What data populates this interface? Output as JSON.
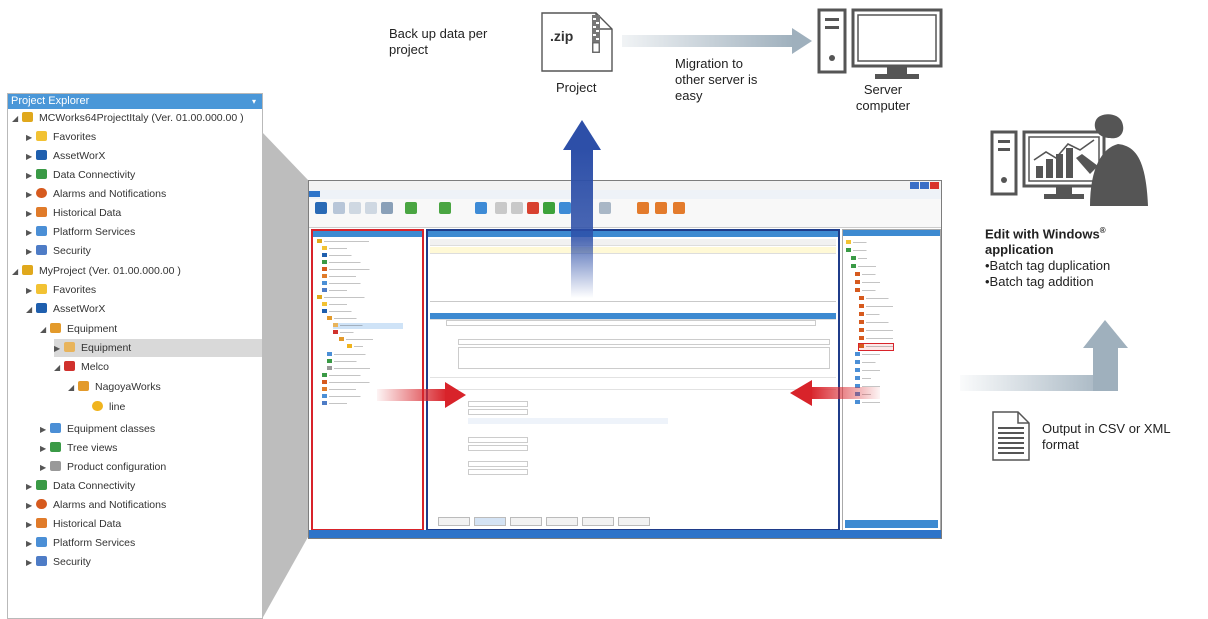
{
  "annotations": {
    "backup_line1": "Back up data per",
    "backup_line2": "project",
    "migration_line1": "Migration to",
    "migration_line2": "other server is",
    "migration_line3": "easy",
    "project_label": "Project",
    "server_line1": "Server",
    "server_line2": "computer",
    "edit_title_line1": "Edit with Windows",
    "edit_title_reg": "®",
    "edit_title_line2": "application",
    "bullet1": "•Batch tag duplication",
    "bullet2": "•Batch tag addition",
    "output_line1": "Output in CSV or XML",
    "output_line2": "format"
  },
  "zip_icon": {
    "label": ".zip"
  },
  "explorer": {
    "title": "Project Explorer",
    "rows": [
      {
        "label": "MCWorks64ProjectItaly (Ver. 01.00.000.00 )",
        "icon": "project-icon",
        "color": "#e0a81c"
      },
      {
        "label": "Favorites",
        "icon": "star-icon",
        "color": "#f2c233"
      },
      {
        "label": "AssetWorX",
        "icon": "asset-icon",
        "color": "#1f5fae"
      },
      {
        "label": "Data Connectivity",
        "icon": "data-connectivity-icon",
        "color": "#3a9a46"
      },
      {
        "label": "Alarms and Notifications",
        "icon": "alarm-icon",
        "color": "#d65a1e"
      },
      {
        "label": "Historical Data",
        "icon": "history-icon",
        "color": "#e07b2a"
      },
      {
        "label": "Platform Services",
        "icon": "platform-icon",
        "color": "#4b8fd6"
      },
      {
        "label": "Security",
        "icon": "security-icon",
        "color": "#4e7cc6"
      },
      {
        "label": "MyProject (Ver. 01.00.000.00 )",
        "icon": "project-icon",
        "color": "#e0a81c"
      },
      {
        "label": "Favorites",
        "icon": "star-icon",
        "color": "#f2c233"
      },
      {
        "label": "AssetWorX",
        "icon": "asset-icon",
        "color": "#1f5fae"
      },
      {
        "label": "Equipment",
        "icon": "equipment-icon",
        "color": "#e39a2b"
      },
      {
        "label": "Equipment",
        "icon": "equipment-icon",
        "color": "#e8b45c"
      },
      {
        "label": "Melco",
        "icon": "melco-icon",
        "color": "#d0312d"
      },
      {
        "label": "NagoyaWorks",
        "icon": "equipment-icon",
        "color": "#e39a2b"
      },
      {
        "label": "line",
        "icon": "line-icon",
        "color": "#f0b41e"
      },
      {
        "label": "Equipment classes",
        "icon": "classes-icon",
        "color": "#4b8fd6"
      },
      {
        "label": "Tree views",
        "icon": "tree-icon",
        "color": "#3a9a46"
      },
      {
        "label": "Product configuration",
        "icon": "product-icon",
        "color": "#999999"
      },
      {
        "label": "Data Connectivity",
        "icon": "data-connectivity-icon",
        "color": "#3a9a46"
      },
      {
        "label": "Alarms and Notifications",
        "icon": "alarm-icon",
        "color": "#d65a1e"
      },
      {
        "label": "Historical Data",
        "icon": "history-icon",
        "color": "#e07b2a"
      },
      {
        "label": "Platform Services",
        "icon": "platform-icon",
        "color": "#4b8fd6"
      },
      {
        "label": "Security",
        "icon": "security-icon",
        "color": "#4e7cc6"
      }
    ]
  },
  "colors": {
    "red_frame": "#d8232a",
    "blue_frame": "#1f3c8a",
    "accent_blue": "#2e74c9",
    "arrow_gray": "#9fb0bd"
  }
}
